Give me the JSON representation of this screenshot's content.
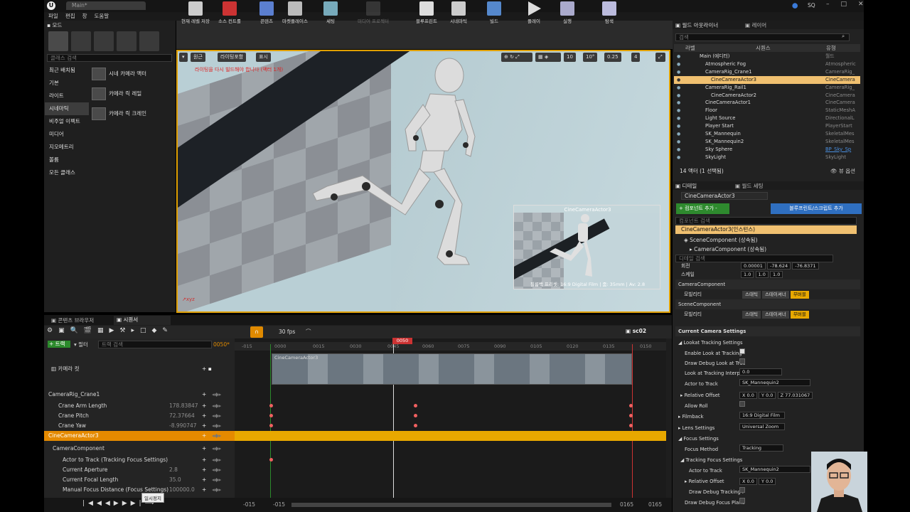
{
  "window": {
    "tab": "Main*",
    "search_label": "SQ"
  },
  "menu": [
    "파일",
    "편집",
    "창",
    "도움말"
  ],
  "modes": {
    "tab": "모드",
    "search_placeholder": "클래스 검색",
    "categories": [
      "최근 배치됨",
      "기본",
      "라이트",
      "시네마틱",
      "비주얼 이펙트",
      "미디어",
      "지오메트리",
      "볼륨",
      "모든 클래스"
    ],
    "selected": "시네마틱",
    "items": [
      "시네 카메라 액터",
      "카메라 릭 레일",
      "카메라 릭 크레인"
    ]
  },
  "toolbar": [
    "현재 레벨 저장",
    "소스 컨트롤",
    "콘텐츠",
    "마켓플레이스",
    "세팅",
    "블루프린트",
    "시네마틱",
    "빌드",
    "플레이",
    "실행",
    "탐색"
  ],
  "toolbar_disabled": "미디어 프로젝터",
  "viewport": {
    "perspective": "원근",
    "lit": "라이팅포함",
    "show": "표시",
    "warning": "라이팅을 다시 빌드해야 합니다 (액터 1개)",
    "snap_a": "10",
    "snap_b": "10°",
    "snap_c": "0.25",
    "cam_speed": "4",
    "pip_title": "CineCameraActor3",
    "pip_footer": "필름백 프리셋: 16:9 Digital Film | 줌: 35mm | Av: 2.8"
  },
  "sequencer": {
    "tab_content": "콘텐츠 브라우저",
    "tab_seq": "시퀀서",
    "fps": "30 fps",
    "seq_name": "sc02",
    "track_btn": "트랙",
    "filter": "필터",
    "search_placeholder": "트랙 검색",
    "current_frame": "0050",
    "current_frame_label": "0050*",
    "ruler": [
      "-015",
      "0000",
      "0015",
      "0030",
      "0045",
      "0060",
      "0075",
      "0090",
      "0105",
      "0120",
      "0135",
      "0150"
    ],
    "start_a": "-015",
    "start_b": "-015",
    "end_a": "0165",
    "end_b": "0165",
    "tooltip": "일시정지",
    "camera_cut": "카메라 컷",
    "camera_cut_clip": "CineCameraActor3",
    "rows": [
      {
        "label": "CameraRig_Crane1",
        "val": ""
      },
      {
        "label": "Crane Arm Length",
        "val": "178.83847"
      },
      {
        "label": "Crane Pitch",
        "val": "72.37664"
      },
      {
        "label": "Crane Yaw",
        "val": "-8.990747"
      },
      {
        "label": "CineCameraActor3",
        "val": ""
      },
      {
        "label": "CameraComponent",
        "val": ""
      },
      {
        "label": "Actor to Track (Tracking Focus Settings)",
        "val": ""
      },
      {
        "label": "Current Aperture",
        "val": "2.8"
      },
      {
        "label": "Current Focal Length",
        "val": "35.0"
      },
      {
        "label": "Manual Focus Distance (Focus Settings)",
        "val": "100000.0"
      }
    ]
  },
  "outliner": {
    "tab_a": "월드 아웃라이너",
    "tab_b": "레이어",
    "search_placeholder": "검색",
    "col_label": "라벨",
    "col_seq": "시퀀스",
    "col_type": "유형",
    "count": "14 액터 (1 선택됨)",
    "view_opts": "뷰 옵션",
    "rows": [
      {
        "name": "Main (에디터)",
        "type": "월드"
      },
      {
        "name": "Atmospheric Fog",
        "type": "Atmospheric"
      },
      {
        "name": "CameraRig_Crane1",
        "type": "CameraRig_"
      },
      {
        "name": "CineCameraActor3",
        "type": "CineCamera"
      },
      {
        "name": "CameraRig_Rail1",
        "type": "CameraRig_"
      },
      {
        "name": "CineCameraActor2",
        "type": "CineCamera"
      },
      {
        "name": "CineCameraActor1",
        "type": "CineCamera"
      },
      {
        "name": "Floor",
        "type": "StaticMeshA"
      },
      {
        "name": "Light Source",
        "type": "DirectionalL"
      },
      {
        "name": "Player Start",
        "type": "PlayerStart"
      },
      {
        "name": "SK_Mannequin",
        "type": "SkeletalMes"
      },
      {
        "name": "SK_Mannequin2",
        "type": "SkeletalMes"
      },
      {
        "name": "Sky Sphere",
        "type": "BP_Sky_Sp"
      },
      {
        "name": "SkyLight",
        "type": "SkyLight"
      }
    ]
  },
  "details": {
    "tab_a": "디테일",
    "tab_b": "월드 세팅",
    "actor_name": "CineCameraActor3",
    "add_component": "+ 컴포넌트 추가 -",
    "add_bp": "블루프린트/스크립트 추가",
    "comp_search": "컴포넌트 검색",
    "root": "CineCameraActor3(인스턴스)",
    "scene": "SceneComponent (상속됨)",
    "camera": "CameraComponent (상속됨)",
    "detail_search": "디테일 검색",
    "rot_label": "회전",
    "rot": [
      "0.00001",
      "-78.624",
      "-76.8371"
    ],
    "scale_label": "스케일",
    "scale": [
      "1.0",
      "1.0",
      "1.0"
    ],
    "cam_comp": "CameraComponent",
    "scene_comp": "SceneComponent",
    "mobility": "모빌리티",
    "mob_static": "스태틱",
    "mob_stationary": "스테이셔너",
    "mob_movable": "무버블",
    "cur_cam": "Current Camera Settings",
    "lookat": "Lookat Tracking Settings",
    "enable_lookat": "Enable Look at Tracking",
    "draw_debug": "Draw Debug Look at Trac",
    "interp": "Look at Tracking Interp",
    "interp_val": "0.0",
    "actor_track": "Actor to Track",
    "actor_track_val": "SK_Mannequin2",
    "rel_offset": "Relative Offset",
    "ro": [
      "X 0.0",
      "Y 0.0",
      "Z 77.031067"
    ],
    "allow_roll": "Allow Roll",
    "filmback": "Filmback",
    "filmback_val": "16:9 Digital Film",
    "lens": "Lens Settings",
    "lens_val": "Universal Zoom",
    "focus": "Focus Settings",
    "focus_method": "Focus Method",
    "focus_method_val": "Tracking",
    "tracking_focus": "Tracking Focus Settings",
    "tf_actor": "Actor to Track",
    "tf_actor_val": "SK_Mannequin2",
    "tf_offset": "Relative Offset",
    "tf_ro": [
      "X 0.0",
      "Y 0.0"
    ],
    "draw_tracking": "Draw Debug Tracking F",
    "draw_plane": "Draw Debug Focus Plane"
  }
}
